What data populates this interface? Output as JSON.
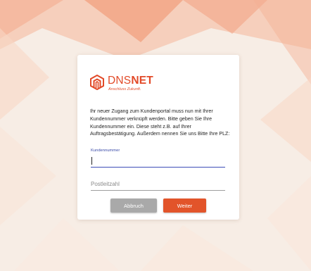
{
  "brand": {
    "name_light": "DNS",
    "name_bold": "NET",
    "tagline": "Anschluss Zukunft.",
    "color": "#e24a28"
  },
  "dialog": {
    "message": "Ihr neuer Zugang zum Kundenportal muss nun mit Ihrer Kundennummer verknüpft werden. Bitte geben Sie Ihre Kundennummer ein. Diese steht z.B. auf Ihrer Auftragsbestätigung. Außerdem nennen Sie uns Bitte Ihre PLZ:",
    "customer_number": {
      "label": "Kundennummer",
      "value": ""
    },
    "postal_code": {
      "placeholder": "Postleitzahl",
      "value": ""
    },
    "cancel_label": "Abbruch",
    "next_label": "Weiter"
  },
  "colors": {
    "accent": "#e2542a",
    "focus": "#3d4db7",
    "cancel": "#a9a9a9",
    "background": "#f6ece4"
  },
  "icons": [
    "dnsnet-logo-icon"
  ]
}
